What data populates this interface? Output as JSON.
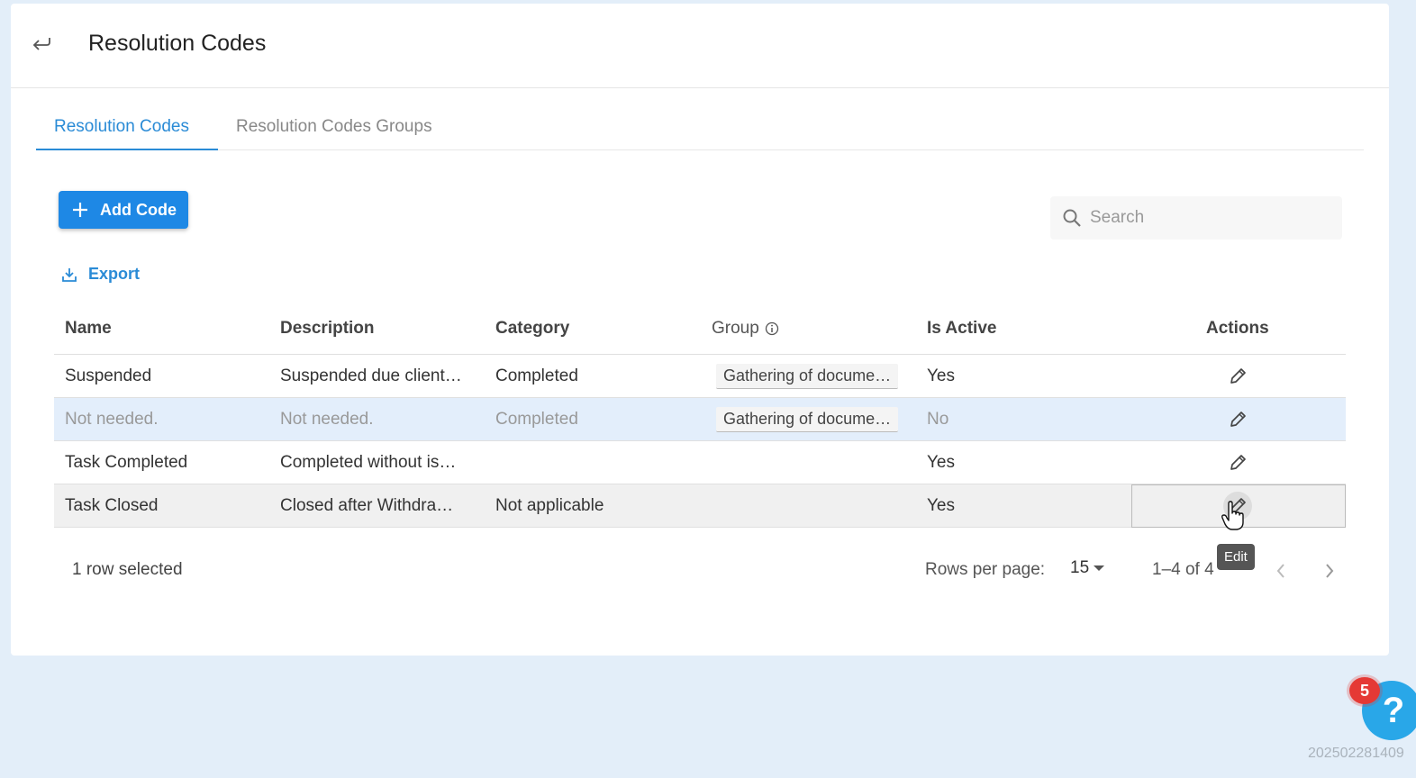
{
  "header": {
    "title": "Resolution Codes"
  },
  "tabs": [
    {
      "label": "Resolution Codes",
      "active": true
    },
    {
      "label": "Resolution Codes Groups",
      "active": false
    }
  ],
  "toolbar": {
    "add_label": "Add Code",
    "export_label": "Export",
    "search_placeholder": "Search"
  },
  "table": {
    "columns": [
      "Name",
      "Description",
      "Category",
      "Group",
      "Is Active",
      "Actions"
    ],
    "rows": [
      {
        "name": "Suspended",
        "description": "Suspended due client…",
        "category": "Completed",
        "group": "Gathering of docume…",
        "active": "Yes"
      },
      {
        "name": "Not needed.",
        "description": "Not needed.",
        "category": "Completed",
        "group": "Gathering of docume…",
        "active": "No"
      },
      {
        "name": "Task Completed",
        "description": "Completed without is…",
        "category": "",
        "group": "",
        "active": "Yes"
      },
      {
        "name": "Task Closed",
        "description": "Closed after Withdra…",
        "category": "Not applicable",
        "group": "",
        "active": "Yes"
      }
    ]
  },
  "footer": {
    "selected": "1 row selected",
    "rows_per_page_label": "Rows per page:",
    "rows_per_page": "15",
    "range": "1–4 of 4"
  },
  "tooltip": "Edit",
  "help": {
    "badge": "5",
    "icon": "?"
  },
  "build": "202502281409",
  "colors": {
    "accent": "#1e88e5",
    "selected_row": "#e3eefb",
    "badge": "#e53935",
    "help": "#29a7e8"
  }
}
